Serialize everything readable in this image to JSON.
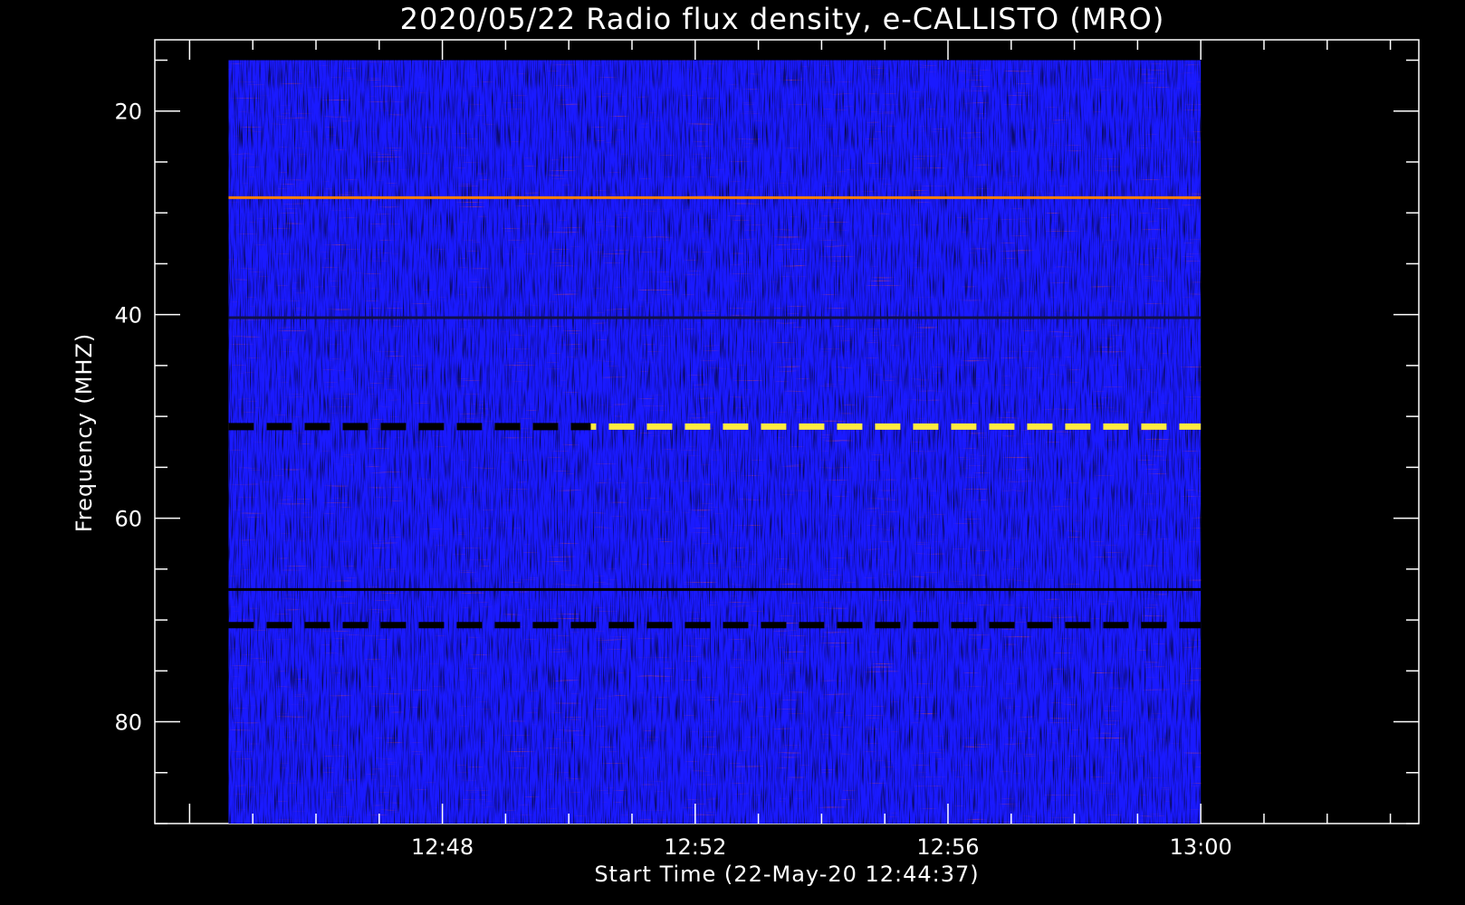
{
  "chart_data": {
    "type": "heatmap",
    "title": "2020/05/22  Radio flux density, e-CALLISTO (MRO)",
    "xlabel": "Start Time (22-May-20 12:44:37)",
    "ylabel": "Frequency (MHZ)",
    "x_unit": "time of day (HH:MM)",
    "y_unit": "MHz",
    "x_range": [
      "12:44:37",
      "13:00:00"
    ],
    "x_axis_range": [
      "12:43:27",
      "13:03:27"
    ],
    "y_range": [
      15,
      90
    ],
    "y_axis_range": [
      13,
      90
    ],
    "y_inverted": true,
    "x_ticks": [
      "12:48",
      "12:52",
      "12:56",
      "13:00"
    ],
    "x_minor_ticks_minutes": 1,
    "y_ticks": [
      20,
      40,
      60,
      80
    ],
    "y_minor_step": 5,
    "grid": false,
    "colormap": [
      "#000000",
      "#1a1aff",
      "#a01020",
      "#ff3000",
      "#ffff40"
    ],
    "background": "#000000",
    "features": [
      {
        "kind": "horizontal_band",
        "freq_mhz": 51,
        "color": "#ffea40",
        "dashed": true
      },
      {
        "kind": "horizontal_band",
        "freq_mhz": 70.5,
        "color": "#000000",
        "dashed": true
      },
      {
        "kind": "horizontal_band",
        "freq_mhz": 28.5,
        "color": "#ff8000",
        "dashed": false
      },
      {
        "kind": "horizontal_band",
        "freq_mhz": 40.3,
        "color": "#10104a",
        "dashed": false
      },
      {
        "kind": "horizontal_band",
        "freq_mhz": 67,
        "color": "#000000",
        "dashed": false
      }
    ]
  }
}
